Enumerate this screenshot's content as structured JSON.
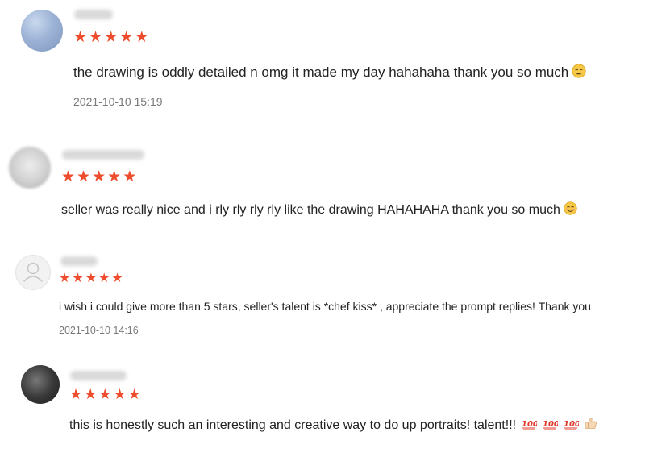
{
  "colors": {
    "star": "#ee4d2d",
    "text": "#222222",
    "timestamp": "#7a7a7a"
  },
  "reviews": [
    {
      "rating": 5,
      "text": "the drawing is oddly detailed n omg it made my day hahahaha thank you so much",
      "emoji": "weary-face-icon",
      "timestamp": "2021-10-10 15:19"
    },
    {
      "rating": 5,
      "text": "seller was really nice and i rly rly rly rly like the drawing HAHAHAHA thank you so much",
      "emoji": "smiling-face-icon"
    },
    {
      "rating": 5,
      "text": "i wish i could give more than 5 stars, seller's talent is *chef kiss* , appreciate the prompt replies! Thank you",
      "timestamp": "2021-10-10 14:16"
    },
    {
      "rating": 5,
      "text": "this is honestly such an interesting and creative way to do up portraits! talent!!!",
      "emoji": "hundred-points-icon x3, thumbs-up-icon"
    }
  ]
}
